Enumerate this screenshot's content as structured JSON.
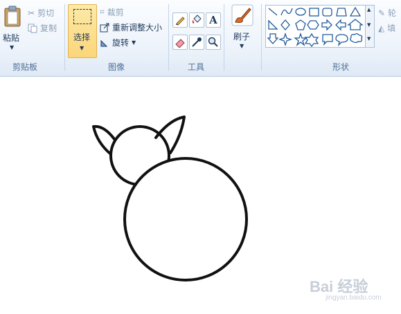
{
  "clipboard": {
    "paste_label": "粘贴",
    "cut_label": "剪切",
    "copy_label": "复制",
    "group_label": "剪贴板"
  },
  "image": {
    "select_label": "选择",
    "crop_label": "裁剪",
    "resize_label": "重新调整大小",
    "rotate_label": "旋转",
    "group_label": "图像"
  },
  "tools": {
    "group_label": "工具"
  },
  "brushes": {
    "label": "刷子"
  },
  "shapes": {
    "group_label": "形状",
    "outline_label": "轮",
    "fill_label": "填"
  },
  "watermark": {
    "brand": "Bai 经验",
    "url": "jingyan.baidu.com"
  },
  "colors": {
    "selected_bg": "#fbd67a",
    "stroke": "#111111"
  }
}
